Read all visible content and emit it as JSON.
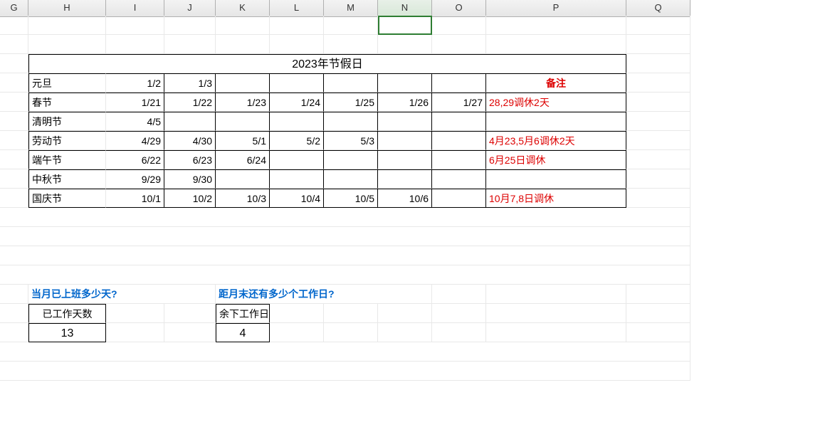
{
  "columns": [
    "G",
    "H",
    "I",
    "J",
    "K",
    "L",
    "M",
    "N",
    "O",
    "P",
    "Q"
  ],
  "selectedCol": "N",
  "title": "2023年节假日",
  "remarkHeader": "备注",
  "holidays": [
    {
      "name": "元旦",
      "dates": [
        "1/2",
        "1/3",
        "",
        "",
        "",
        "",
        ""
      ],
      "remark": "备注",
      "remarkIsHeader": true
    },
    {
      "name": "春节",
      "dates": [
        "1/21",
        "1/22",
        "1/23",
        "1/24",
        "1/25",
        "1/26",
        "1/27"
      ],
      "remark": "28,29调休2天"
    },
    {
      "name": "清明节",
      "dates": [
        "4/5",
        "",
        "",
        "",
        "",
        "",
        ""
      ],
      "remark": ""
    },
    {
      "name": "劳动节",
      "dates": [
        "4/29",
        "4/30",
        "5/1",
        "5/2",
        "5/3",
        "",
        ""
      ],
      "remark": "4月23,5月6调休2天"
    },
    {
      "name": "端午节",
      "dates": [
        "6/22",
        "6/23",
        "6/24",
        "",
        "",
        "",
        ""
      ],
      "remark": "6月25日调休"
    },
    {
      "name": "中秋节",
      "dates": [
        "9/29",
        "9/30",
        "",
        "",
        "",
        "",
        ""
      ],
      "remark": ""
    },
    {
      "name": "国庆节",
      "dates": [
        "10/1",
        "10/2",
        "10/3",
        "10/4",
        "10/5",
        "10/6",
        ""
      ],
      "remark": "10月7,8日调休"
    }
  ],
  "q1": {
    "question": "当月已上班多少天?",
    "label": "已工作天数",
    "value": "13"
  },
  "q2": {
    "question": "距月末还有多少个工作日?",
    "label": "余下工作日",
    "value": "4"
  }
}
